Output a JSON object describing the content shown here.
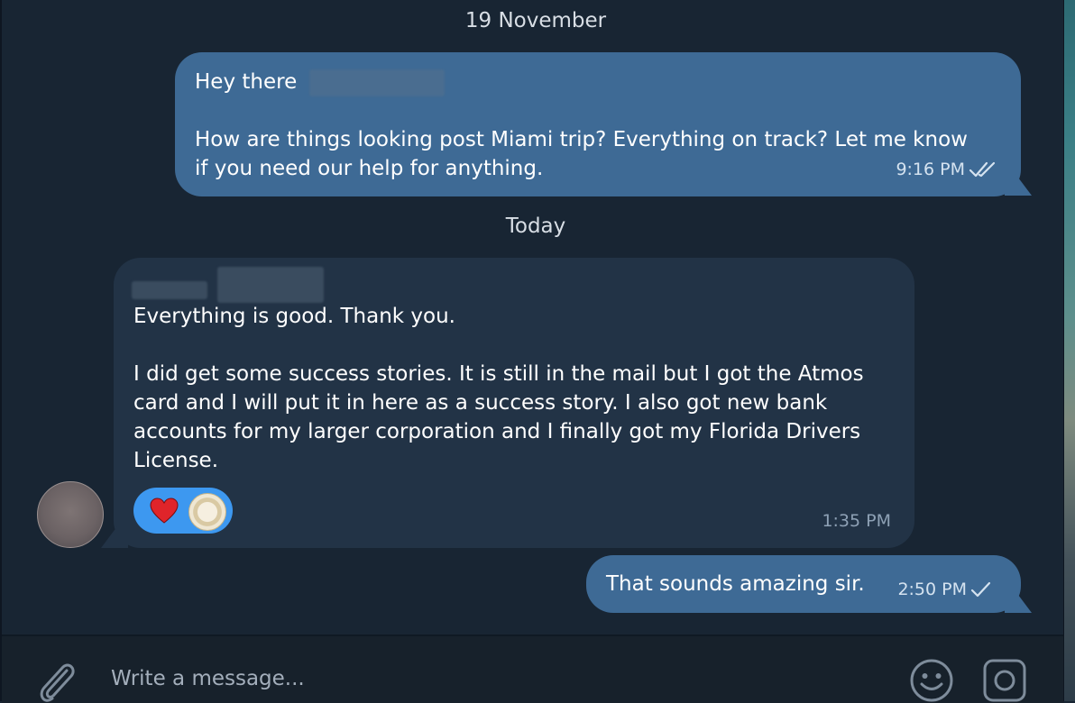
{
  "dates": {
    "first": "19 November",
    "second": "Today"
  },
  "messages": [
    {
      "direction": "outgoing",
      "greeting": "Hey there",
      "body": "How are things looking post Miami trip? Everything on track? Let me know\nif you need our help for anything.",
      "time": "9:16 PM",
      "status": "read-double-check-icon"
    },
    {
      "direction": "incoming",
      "body": "Everything is good. Thank you.\n\nI did get some success stories. It is still in the mail but I got the Atmos\ncard and I will put it in here as a success story. I also got new bank\naccounts for my larger corporation and I finally got my Florida Drivers\nLicense.",
      "time": "1:35 PM",
      "reactions": [
        "heart",
        "badge-sticker"
      ]
    },
    {
      "direction": "outgoing",
      "body": "That sounds amazing sir.",
      "time": "2:50 PM",
      "status": "sent-single-check-icon"
    }
  ],
  "composer": {
    "placeholder": "Write a message..."
  },
  "icons": {
    "attach": "paperclip-icon",
    "emoji": "emoji-icon",
    "instant_view": "camera-square-icon"
  },
  "colors": {
    "background": "#182533",
    "outgoing_bubble": "#3e6a95",
    "incoming_bubble": "#223346",
    "reaction_pill": "#3d98f0",
    "heart": "#e0242a"
  }
}
